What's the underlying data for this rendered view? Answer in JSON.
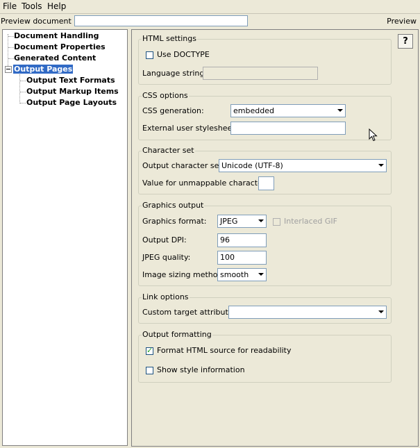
{
  "menu": {
    "file": "File",
    "tools": "Tools",
    "help": "Help"
  },
  "preview_bar": {
    "label": "Preview document ID:",
    "value": "",
    "preview_label": "Preview"
  },
  "tree": {
    "items": [
      {
        "label": "Document Handling"
      },
      {
        "label": "Document Properties"
      },
      {
        "label": "Generated Content"
      },
      {
        "label": "Output Pages"
      },
      {
        "label": "Output Text Formats"
      },
      {
        "label": "Output Markup Items"
      },
      {
        "label": "Output Page Layouts"
      }
    ]
  },
  "help_button": "?",
  "html_settings": {
    "title": "HTML settings",
    "use_doctype_label": "Use DOCTYPE",
    "use_doctype_checked": false,
    "language_label": "Language string:",
    "language_value": ""
  },
  "css_options": {
    "title": "CSS options",
    "generation_label": "CSS generation:",
    "generation_value": "embedded",
    "external_label": "External user stylesheet:",
    "external_value": ""
  },
  "charset": {
    "title": "Character set",
    "output_label": "Output character set:",
    "output_value": "Unicode (UTF-8)",
    "unmappable_label": "Value for unmappable characters:",
    "unmappable_value": ""
  },
  "graphics": {
    "title": "Graphics output",
    "format_label": "Graphics format:",
    "format_value": "JPEG",
    "interlaced_label": "Interlaced GIF",
    "dpi_label": "Output DPI:",
    "dpi_value": "96",
    "quality_label": "JPEG quality:",
    "quality_value": "100",
    "sizing_label": "Image sizing method:",
    "sizing_value": "smooth"
  },
  "link": {
    "title": "Link options",
    "target_label": "Custom target attribute:",
    "target_value": ""
  },
  "formatting": {
    "title": "Output formatting",
    "readability_label": "Format HTML source for readability",
    "readability_checked": true,
    "style_label": "Show style information",
    "style_checked": false
  }
}
